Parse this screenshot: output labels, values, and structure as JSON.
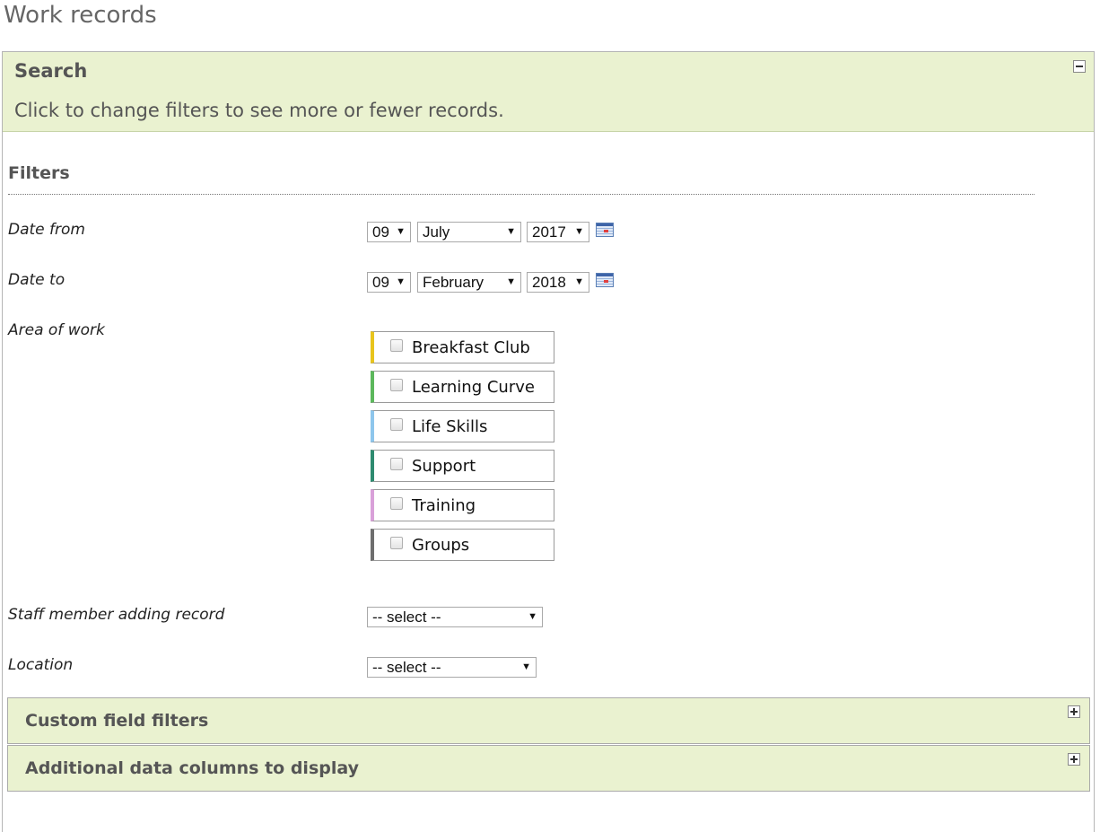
{
  "page": {
    "title": "Work records"
  },
  "search": {
    "title": "Search",
    "subtitle": "Click to change filters to see more or fewer records."
  },
  "filters": {
    "heading": "Filters",
    "date_from": {
      "label": "Date from",
      "day": "09",
      "month": "July",
      "year": "2017",
      "icon": "calendar-icon"
    },
    "date_to": {
      "label": "Date to",
      "day": "09",
      "month": "February",
      "year": "2018",
      "icon": "calendar-icon"
    },
    "area_of_work": {
      "label": "Area of work",
      "items": [
        {
          "label": "Breakfast Club",
          "color": "#e8c41c",
          "checked": false
        },
        {
          "label": "Learning Curve",
          "color": "#5cb85c",
          "checked": false
        },
        {
          "label": "Life Skills",
          "color": "#8ec6ec",
          "checked": false
        },
        {
          "label": "Support",
          "color": "#2e8b70",
          "checked": false
        },
        {
          "label": "Training",
          "color": "#d9a0d9",
          "checked": false
        },
        {
          "label": "Groups",
          "color": "#6e6e6e",
          "checked": false
        }
      ]
    },
    "staff_member": {
      "label": "Staff member adding record",
      "value": "-- select --"
    },
    "location": {
      "label": "Location",
      "value": "-- select --"
    }
  },
  "custom_field_filters": {
    "title": "Custom field filters"
  },
  "additional_columns": {
    "title": "Additional data columns to display"
  },
  "colors": {
    "panel_header_bg": "#eaf2d0",
    "heading_text": "#555555"
  }
}
